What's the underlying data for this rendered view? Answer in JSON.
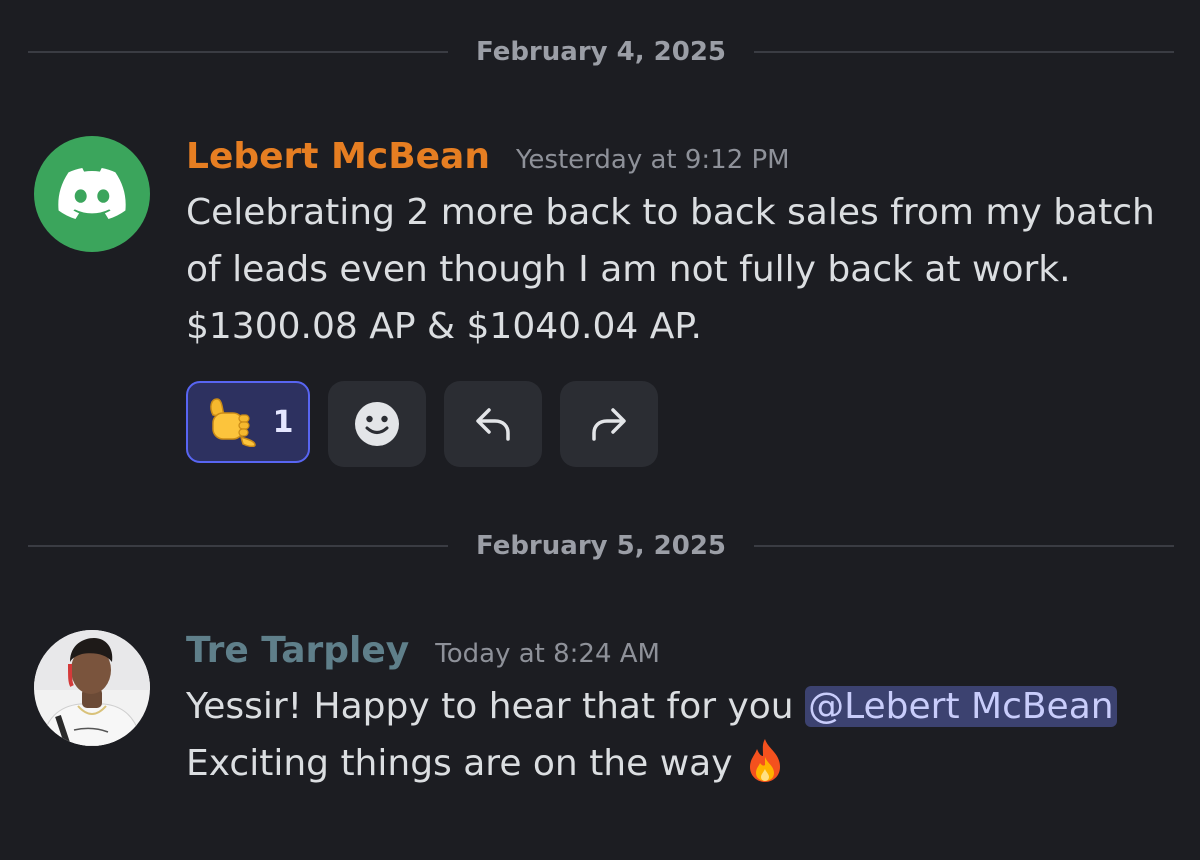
{
  "dividers": [
    {
      "date": "February 4, 2025"
    },
    {
      "date": "February 5, 2025"
    }
  ],
  "messages": [
    {
      "username": "Lebert McBean",
      "username_color": "#e67e22",
      "timestamp": "Yesterday at 9:12 PM",
      "lines": [
        "Celebrating 2 more back to back sales from my batch",
        "of leads even though I am not fully back at work.",
        "$1300.08 AP & $1040.04 AP."
      ],
      "reaction": {
        "emoji": "call-me-hand",
        "count": "1"
      },
      "action_icons": [
        "add-reaction-icon",
        "reply-icon",
        "forward-icon"
      ]
    },
    {
      "username": "Tre Tarpley",
      "username_color": "#5f7f8a",
      "timestamp": "Today at 8:24 AM",
      "line1_text": "Yessir! Happy to hear that for you ",
      "mention": "@Lebert McBean",
      "line2_text": "Exciting things are on the way "
    }
  ]
}
